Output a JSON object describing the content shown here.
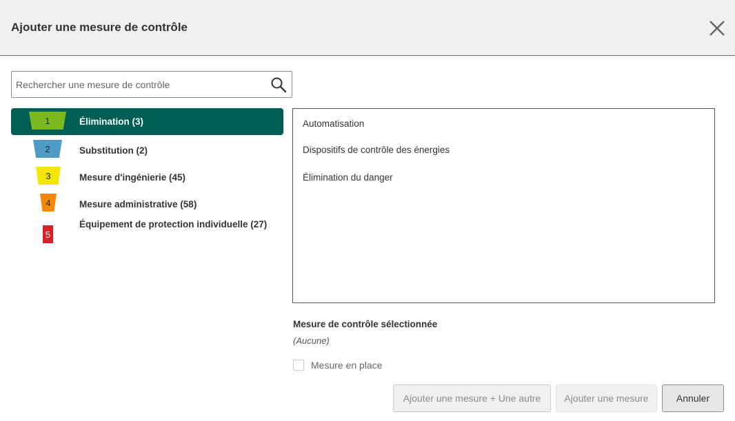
{
  "dialog": {
    "title": "Ajouter une mesure de contrôle",
    "close_icon": "close-icon"
  },
  "search": {
    "placeholder": "Rechercher une mesure de contrôle",
    "value": "",
    "icon": "search-icon"
  },
  "categories": [
    {
      "number": "1",
      "label": "Élimination (3)",
      "color": "#7cb820",
      "selected": true
    },
    {
      "number": "2",
      "label": "Substitution (2)",
      "color": "#4f9bc8",
      "selected": false
    },
    {
      "number": "3",
      "label": "Mesure d'ingénierie (45)",
      "color": "#f5e600",
      "selected": false
    },
    {
      "number": "4",
      "label": "Mesure administrative (58)",
      "color": "#f58a00",
      "selected": false
    },
    {
      "number": "5",
      "label": "Équipement de protection individuelle (27)",
      "color": "#d8202a",
      "selected": false
    }
  ],
  "measures": [
    "Automatisation",
    "Dispositifs de contrôle des énergies",
    "Élimination du danger"
  ],
  "selection": {
    "title": "Mesure de contrôle sélectionnée",
    "value": "(Aucune)"
  },
  "in_place": {
    "label": "Mesure en place",
    "checked": false
  },
  "buttons": {
    "add_another": "Ajouter une mesure + Une autre",
    "add": "Ajouter une mesure",
    "cancel": "Annuler"
  },
  "colors": {
    "accent": "#005e55",
    "header_bg": "#f0f0f0"
  }
}
